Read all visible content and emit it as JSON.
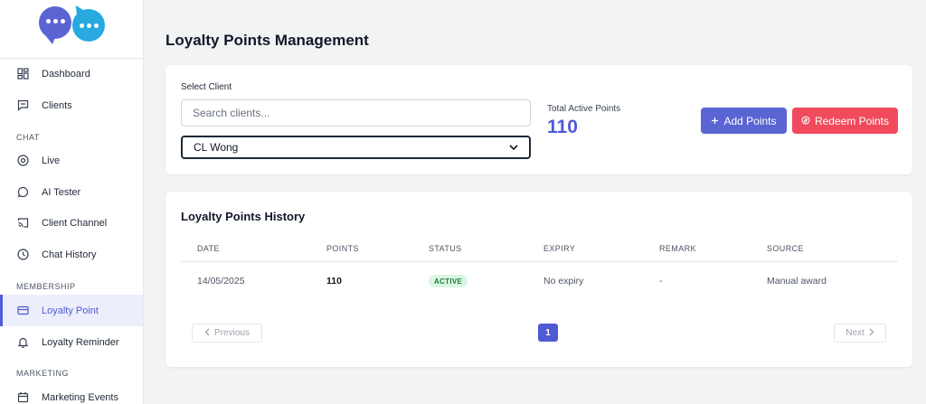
{
  "sidebar": {
    "items": [
      {
        "label": "Dashboard",
        "icon": "dashboard-icon"
      },
      {
        "label": "Clients",
        "icon": "message-square-icon"
      },
      {
        "label": "Live",
        "icon": "target-icon"
      },
      {
        "label": "AI Tester",
        "icon": "chat-bubble-icon"
      },
      {
        "label": "Client Channel",
        "icon": "cast-icon"
      },
      {
        "label": "Chat History",
        "icon": "clock-icon"
      },
      {
        "label": "Loyalty Point",
        "icon": "card-icon",
        "active": true
      },
      {
        "label": "Loyalty Reminder",
        "icon": "bell-icon"
      },
      {
        "label": "Marketing Events",
        "icon": "calendar-icon"
      }
    ],
    "sections": {
      "chat": "CHAT",
      "membership": "MEMBERSHIP",
      "marketing": "MARKETING"
    }
  },
  "page": {
    "title": "Loyalty Points Management"
  },
  "client_panel": {
    "select_label": "Select Client",
    "search_placeholder": "Search clients...",
    "selected_client": "CL Wong",
    "total_active_points_label": "Total Active Points",
    "total_active_points_value": "110",
    "add_points_label": "Add Points",
    "redeem_points_label": "Redeem Points"
  },
  "history": {
    "title": "Loyalty Points History",
    "columns": [
      "DATE",
      "POINTS",
      "STATUS",
      "EXPIRY",
      "REMARK",
      "SOURCE"
    ],
    "rows": [
      {
        "date": "14/05/2025",
        "points": "110",
        "status": "ACTIVE",
        "expiry": "No expiry",
        "remark": "-",
        "source": "Manual award"
      }
    ],
    "pagination": {
      "previous_label": "Previous",
      "next_label": "Next",
      "current_page": "1"
    }
  },
  "colors": {
    "accent": "#4f5bd5",
    "danger": "#f04a5c",
    "active_badge_bg": "#dcf5e3",
    "active_badge_text": "#1a7f3c"
  }
}
